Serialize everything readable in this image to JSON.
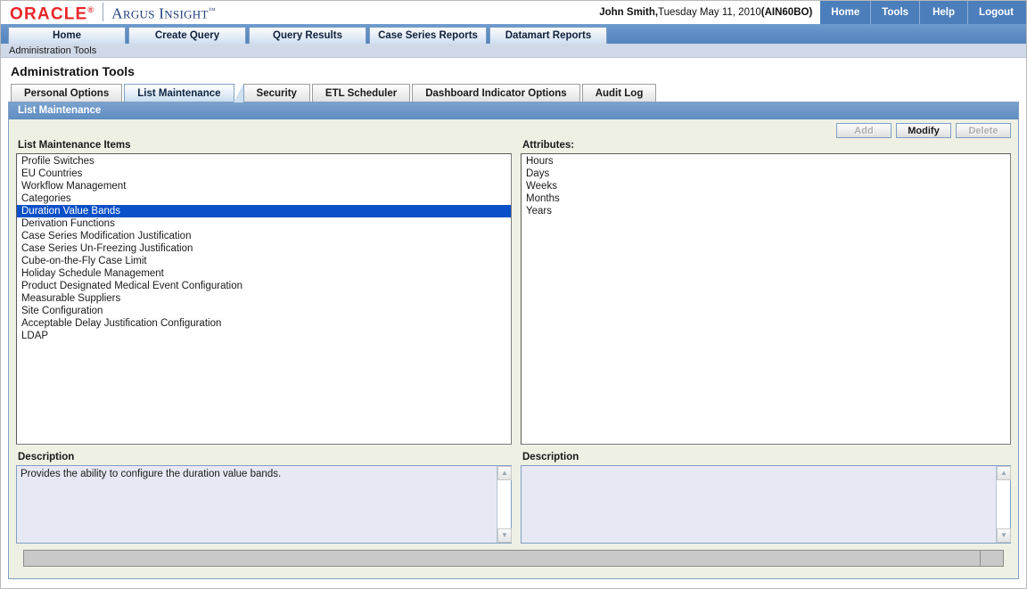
{
  "header": {
    "brand_oracle": "ORACLE",
    "brand_oracle_reg": "®",
    "brand_product_a": "A",
    "brand_product_rgus": "RGUS",
    "brand_product_i": "I",
    "brand_product_nsight": "NSIGHT",
    "brand_product_tm": "™",
    "user_name": "John Smith,",
    "user_session": " Tuesday May 11, 2010 ",
    "user_id": "(AIN60BO)",
    "nav": [
      {
        "label": "Home",
        "name": "top-nav-home"
      },
      {
        "label": "Tools",
        "name": "top-nav-tools"
      },
      {
        "label": "Help",
        "name": "top-nav-help"
      },
      {
        "label": "Logout",
        "name": "top-nav-logout"
      }
    ]
  },
  "main_nav": {
    "tabs": [
      {
        "label": "Home"
      },
      {
        "label": "Create Query"
      },
      {
        "label": "Query Results"
      },
      {
        "label": "Case Series Reports"
      },
      {
        "label": "Datamart Reports"
      }
    ]
  },
  "breadcrumb": {
    "text": "Administration Tools"
  },
  "page": {
    "title": "Administration Tools"
  },
  "sub_tabs": [
    {
      "label": "Personal Options",
      "active": false
    },
    {
      "label": "List Maintenance",
      "active": true
    },
    {
      "label": "Security",
      "active": false
    },
    {
      "label": "ETL Scheduler",
      "active": false
    },
    {
      "label": "Dashboard Indicator Options",
      "active": false
    },
    {
      "label": "Audit Log",
      "active": false
    }
  ],
  "panel": {
    "title": "List Maintenance",
    "buttons": [
      {
        "label": "Add",
        "disabled": true
      },
      {
        "label": "Modify",
        "disabled": false
      },
      {
        "label": "Delete",
        "disabled": true
      }
    ],
    "left": {
      "label": "List Maintenance Items",
      "items": [
        {
          "label": "Profile Switches",
          "selected": false
        },
        {
          "label": "EU Countries",
          "selected": false
        },
        {
          "label": "Workflow Management",
          "selected": false
        },
        {
          "label": "Categories",
          "selected": false
        },
        {
          "label": "Duration Value Bands",
          "selected": true
        },
        {
          "label": "Derivation Functions",
          "selected": false
        },
        {
          "label": "Case Series Modification Justification",
          "selected": false
        },
        {
          "label": "Case Series Un-Freezing Justification",
          "selected": false
        },
        {
          "label": "Cube-on-the-Fly Case Limit",
          "selected": false
        },
        {
          "label": "Holiday Schedule Management",
          "selected": false
        },
        {
          "label": "Product Designated Medical Event Configuration",
          "selected": false
        },
        {
          "label": "Measurable Suppliers",
          "selected": false
        },
        {
          "label": "Site Configuration",
          "selected": false
        },
        {
          "label": "Acceptable Delay Justification Configuration",
          "selected": false
        },
        {
          "label": "LDAP",
          "selected": false
        }
      ],
      "description_label": "Description",
      "description_value": "Provides the ability to configure the duration value bands."
    },
    "right": {
      "label": "Attributes:",
      "items": [
        {
          "label": "Hours",
          "selected": false
        },
        {
          "label": "Days",
          "selected": false
        },
        {
          "label": "Weeks",
          "selected": false
        },
        {
          "label": "Months",
          "selected": false
        },
        {
          "label": "Years",
          "selected": false
        }
      ],
      "description_label": "Description",
      "description_value": ""
    }
  },
  "colors": {
    "oracle_red": "#e8262b",
    "argus_blue": "#1f3f7a",
    "nav_blue": "#4c7ebb",
    "panel_header_blue": "#6d97c7",
    "panel_bg": "#eef0e4",
    "selection_blue": "#0a50c8",
    "textarea_bg": "#e7e8f4"
  }
}
